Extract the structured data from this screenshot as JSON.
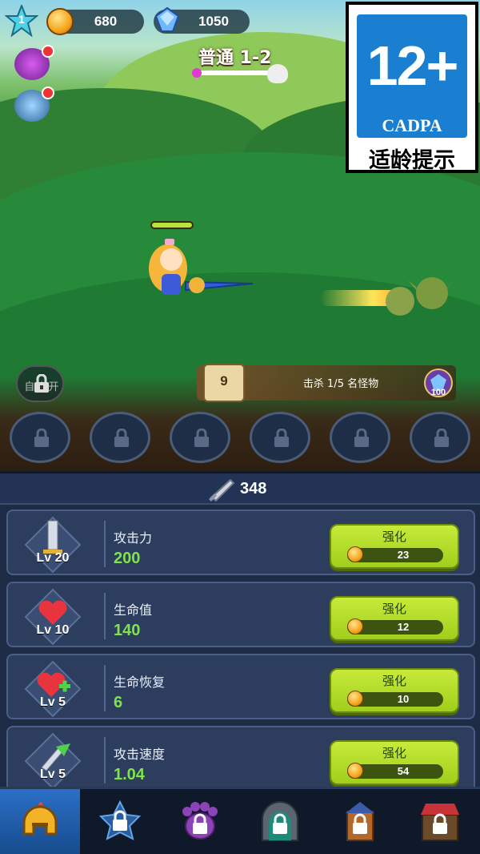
{
  "hud": {
    "player_level": "1",
    "coins": "680",
    "gems": "1050",
    "stage": "普通 1-2"
  },
  "rating": {
    "age": "12+",
    "org": "CADPA",
    "tip": "适龄提示"
  },
  "auto_button": {
    "label": "自动 开"
  },
  "quest": {
    "number": "9",
    "text": "击杀 1/5 名怪物",
    "reward": "100"
  },
  "power": {
    "value": "348"
  },
  "upgrades": [
    {
      "name": "攻击力",
      "level": "Lv 20",
      "value": "200",
      "button": "强化",
      "cost": "23",
      "icon": "sword-icon"
    },
    {
      "name": "生命值",
      "level": "Lv 10",
      "value": "140",
      "button": "强化",
      "cost": "12",
      "icon": "heart-icon"
    },
    {
      "name": "生命恢复",
      "level": "Lv 5",
      "value": "6",
      "button": "强化",
      "cost": "10",
      "icon": "heart-plus-icon"
    },
    {
      "name": "攻击速度",
      "level": "Lv 5",
      "value": "1.04",
      "button": "强化",
      "cost": "54",
      "icon": "swift-sword-icon"
    }
  ],
  "nav": [
    "helmet-tab",
    "star-tab",
    "paw-tab",
    "gate-tab",
    "tower-tab",
    "shop-tab"
  ],
  "colors": {
    "accent_green": "#7fe34c",
    "button_green": "#b6e02c",
    "panel_bg": "#1d2b45"
  }
}
